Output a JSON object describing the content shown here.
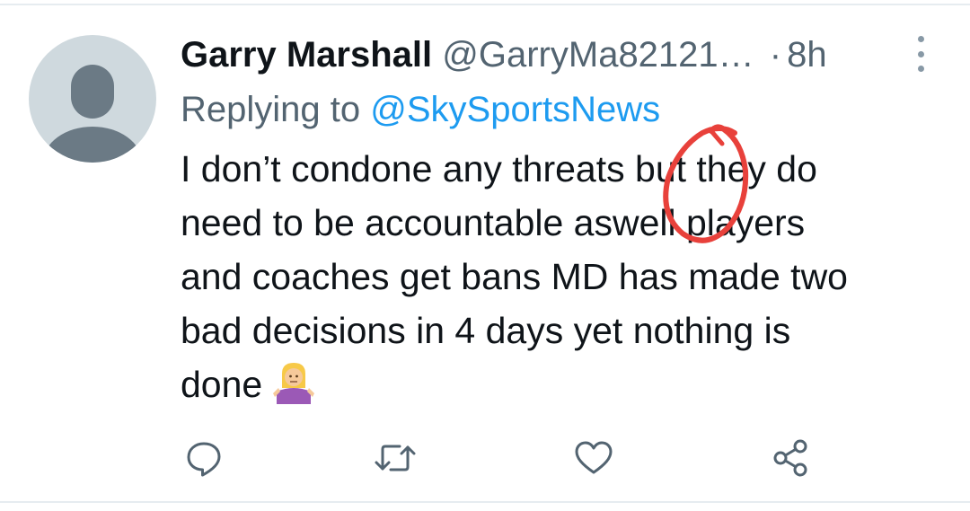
{
  "tweet": {
    "display_name": "Garry Marshall",
    "handle": "@GarryMa82121…",
    "separator": "·",
    "time": "8h",
    "replying_prefix": "Replying to",
    "replying_to": "@SkySportsNews",
    "text_lines": [
      "I don’t condone any threats but they do",
      "need to be accountable aswell players",
      "and coaches get bans MD has made two",
      "bad decisions in 4 days yet nothing is",
      "done"
    ]
  },
  "annotation": {
    "type": "hand-drawn-circle",
    "color": "#e8413b"
  },
  "actions": [
    "reply-icon",
    "retweet-icon",
    "like-icon",
    "share-icon"
  ],
  "colors": {
    "text": "#0f1419",
    "secondary": "#536471",
    "link": "#1d9bf0",
    "icon": "#536471",
    "divider": "#e6ecf0",
    "avatar_bg": "#cfd9de",
    "avatar_fg": "#6b7a85"
  }
}
